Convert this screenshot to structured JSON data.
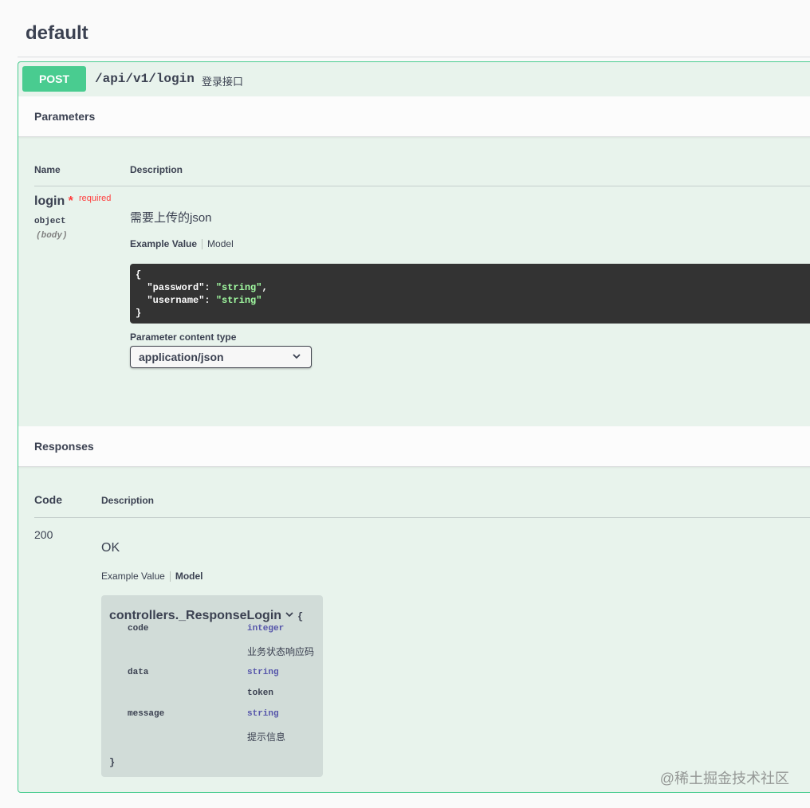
{
  "tag": {
    "title": "default"
  },
  "operation": {
    "method": "POST",
    "path": "/api/v1/login",
    "summary": "登录接口"
  },
  "parameters": {
    "section_label": "Parameters",
    "col_name": "Name",
    "col_description": "Description",
    "items": [
      {
        "name": "login",
        "required_mark": "*",
        "required_label": "required",
        "type": "object",
        "in": "(body)",
        "description": "需要上传的json",
        "tab_example": "Example Value",
        "tab_model": "Model",
        "example_open": "{",
        "example_lines": [
          {
            "key": "\"password\"",
            "value": "\"string\"",
            "comma": ","
          },
          {
            "key": "\"username\"",
            "value": "\"string\"",
            "comma": ""
          }
        ],
        "example_close": "}"
      }
    ],
    "content_type_label": "Parameter content type",
    "content_type_value": "application/json"
  },
  "responses": {
    "section_label": "Responses",
    "col_code": "Code",
    "col_description": "Description",
    "items": [
      {
        "code": "200",
        "description": "OK",
        "tab_example": "Example Value",
        "tab_model": "Model",
        "model": {
          "name": "controllers._ResponseLogin",
          "open": "{",
          "close": "}",
          "properties": [
            {
              "name": "code",
              "type": "integer",
              "description": "业务状态响应码"
            },
            {
              "name": "data",
              "type": "string",
              "description": "token"
            },
            {
              "name": "message",
              "type": "string",
              "description": "提示信息"
            }
          ]
        }
      }
    ]
  },
  "watermark": "@稀土掘金技术社区",
  "colors": {
    "post": "#49cc90",
    "block_bg": "#e8f3ec",
    "code_bg": "#333333",
    "type_color": "#5555aa",
    "required": "#ff3b3b"
  }
}
